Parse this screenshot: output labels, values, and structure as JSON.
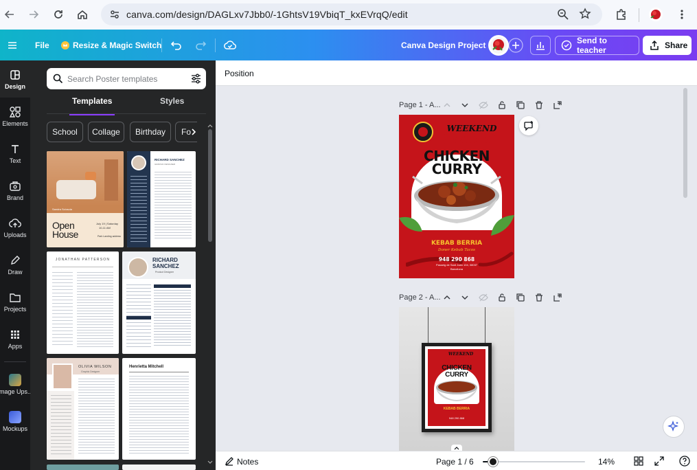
{
  "browser": {
    "url": "canva.com/design/DAGLxv7Jbb0/-1GhtsV19VbiqT_kxEVrqQ/edit",
    "back_icon": "arrow-left-icon",
    "forward_icon": "arrow-right-icon",
    "reload_icon": "reload-icon",
    "home_icon": "home-icon"
  },
  "header": {
    "file_label": "File",
    "resize_label": "Resize & Magic Switch",
    "project_title": "Canva Design Project",
    "send_label": "Send to teacher",
    "share_label": "Share"
  },
  "rail": {
    "items": [
      {
        "label": "Design",
        "icon": "design-icon"
      },
      {
        "label": "Elements",
        "icon": "elements-icon"
      },
      {
        "label": "Text",
        "icon": "text-icon"
      },
      {
        "label": "Brand",
        "icon": "brand-icon"
      },
      {
        "label": "Uploads",
        "icon": "uploads-icon"
      },
      {
        "label": "Draw",
        "icon": "draw-icon"
      },
      {
        "label": "Projects",
        "icon": "projects-icon"
      },
      {
        "label": "Apps",
        "icon": "apps-icon"
      },
      {
        "label": "Image Ups...",
        "icon": "image-upscaler-icon"
      },
      {
        "label": "Mockups",
        "icon": "mockups-icon"
      }
    ]
  },
  "panel": {
    "search_placeholder": "Search Poster templates",
    "tabs": [
      "Templates",
      "Styles"
    ],
    "chips": [
      "School",
      "Collage",
      "Birthday",
      "Fo"
    ],
    "templates": {
      "t1": {
        "label_a": "Sandra Scioscia",
        "label_b": "Open",
        "label_c": "House",
        "date": "July 19 | Saturday",
        "time": "10-11 AM",
        "venue": "Park Landing address"
      },
      "t2": {
        "name": "RICHARD SANCHEZ",
        "role": "GRAPHIC DESIGNER"
      },
      "t3": {
        "name": "JONATHAN PATTERSON"
      },
      "t4": {
        "name_a": "RICHARD",
        "name_b": "SANCHEZ",
        "role": "Product Designer"
      },
      "t5": {
        "name": "OLIVIA WILSON",
        "role": "Graphic Designer"
      },
      "t6": {
        "name": "Henrietta Mitchell"
      }
    }
  },
  "editor": {
    "context_label": "Position",
    "page1_label": "Page 1 - A...",
    "page2_label": "Page 2 - A...",
    "poster": {
      "line1": "WEEKEND",
      "line2": "Special",
      "line3": "CHICKEN",
      "line4": "CURRY",
      "restaurant": "KEBAB BERRIA",
      "tagline": "Doner Kebab Tacos",
      "phone": "948 290 868",
      "address": "Passeig de Sant Joan 104, 08037",
      "city": "Barcelona"
    }
  },
  "bottom": {
    "notes_label": "Notes",
    "page_indicator": "Page 1 / 6",
    "zoom": "14%",
    "zoom_fraction": 0.14
  },
  "colors": {
    "poster_red": "#c5141a",
    "accent_purple": "#8b3dff",
    "header_gradient_start": "#0fb4c9",
    "header_gradient_end": "#7b3cf0"
  }
}
